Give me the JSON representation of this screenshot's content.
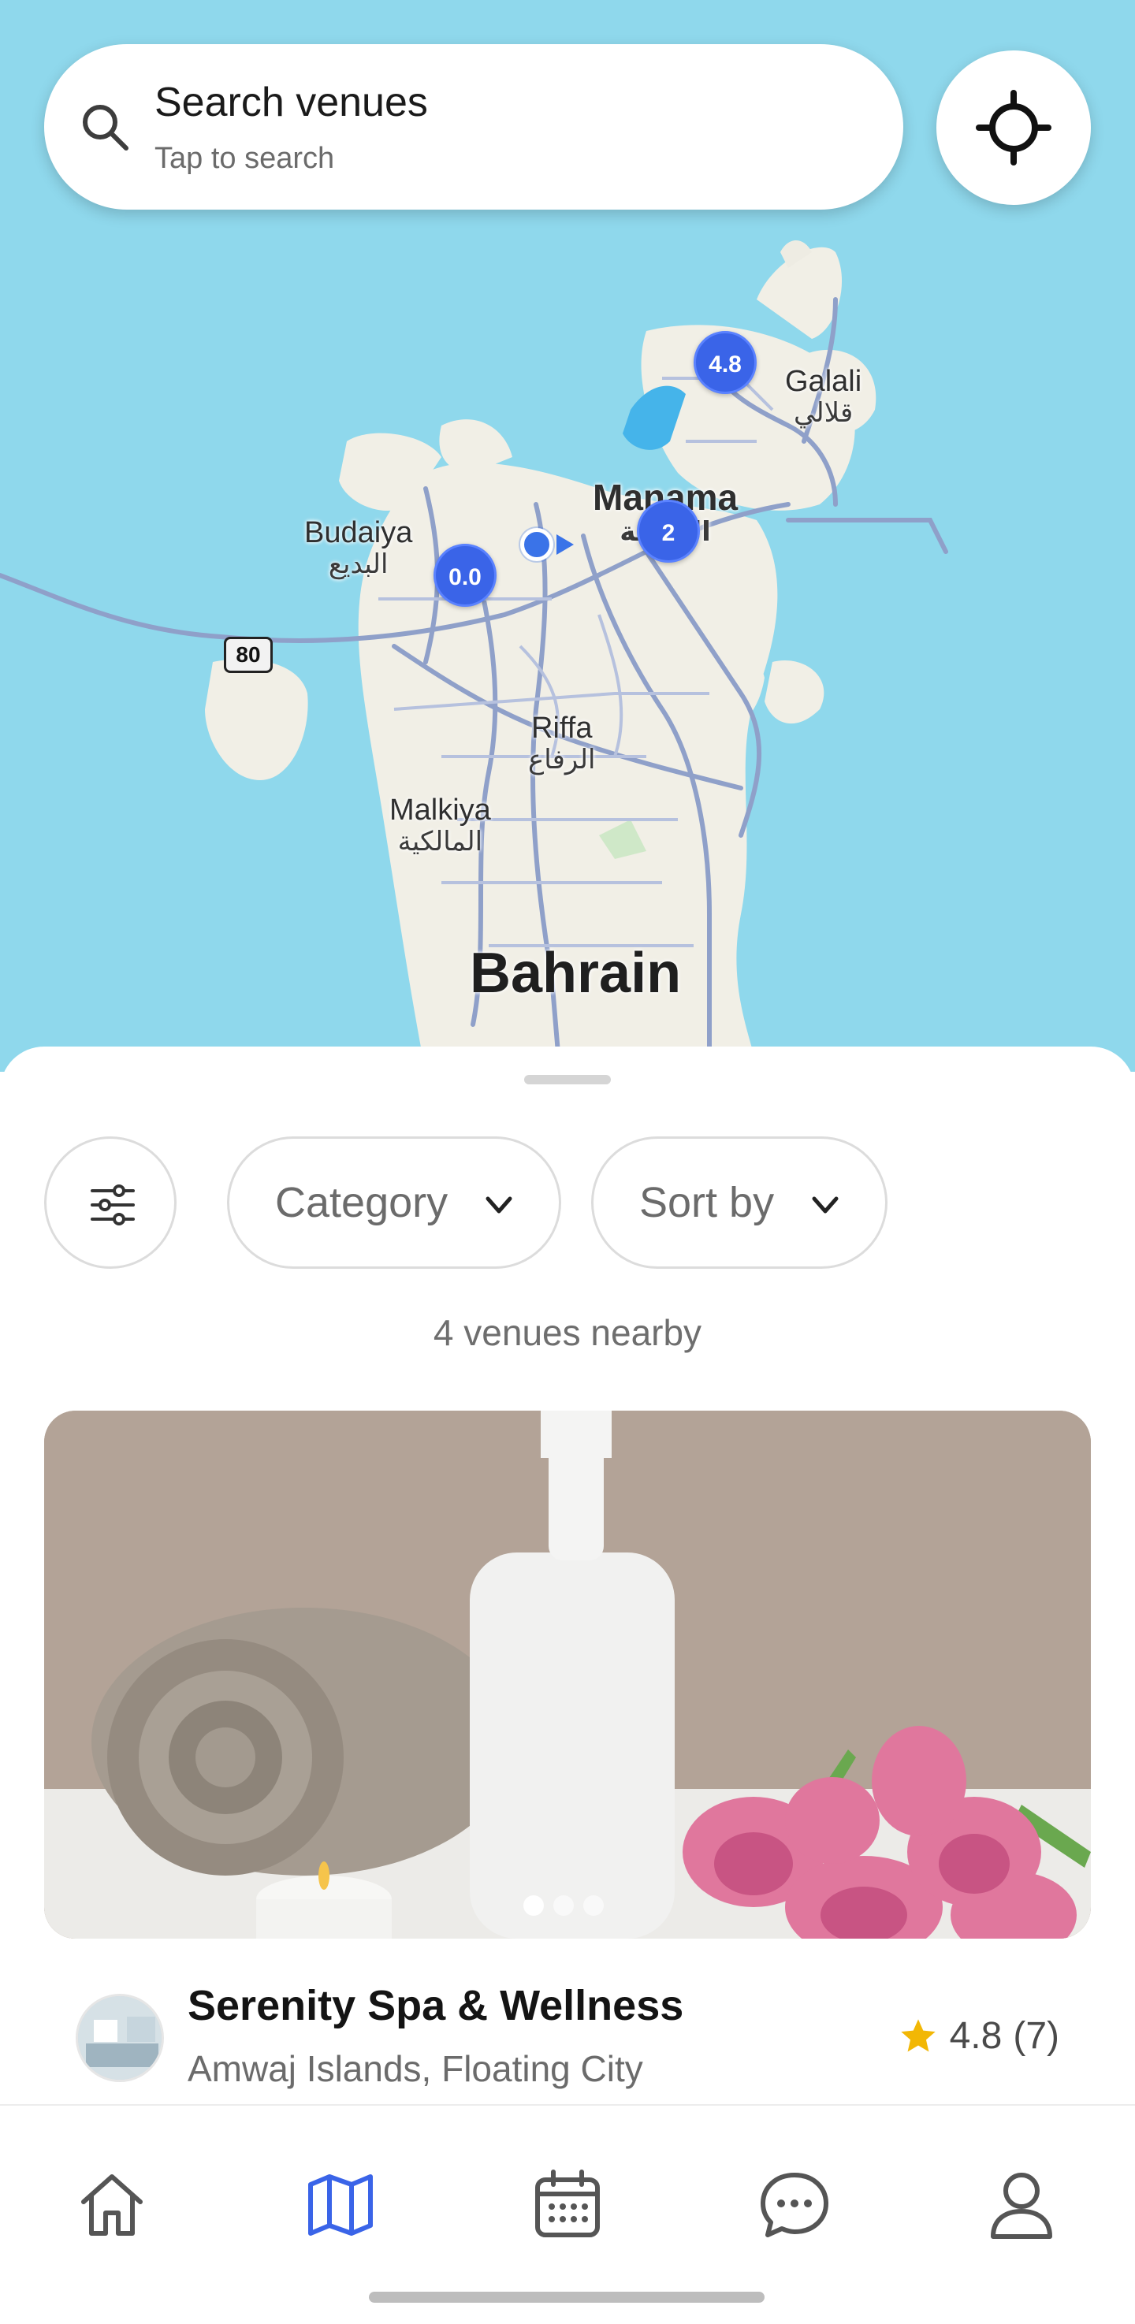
{
  "search": {
    "title": "Search venues",
    "subtitle": "Tap to search"
  },
  "map": {
    "places": [
      {
        "name": "Budaiya",
        "arabic": "البديع"
      },
      {
        "name": "Manama",
        "arabic": "المنامة"
      },
      {
        "name": "Galali",
        "arabic": "قلالي"
      },
      {
        "name": "Riffa",
        "arabic": "الرفاع"
      },
      {
        "name": "Malkiya",
        "arabic": "المالكية"
      },
      {
        "name": "Bahrain"
      }
    ],
    "road_shield": "80",
    "pins": [
      {
        "label": "4.8"
      },
      {
        "label": "2"
      },
      {
        "label": "0.0"
      }
    ]
  },
  "filters": {
    "category_label": "Category",
    "sort_label": "Sort by"
  },
  "results": {
    "count_text": "4 venues nearby"
  },
  "venue": {
    "name": "Serenity Spa & Wellness",
    "location": "Amwaj Islands, Floating City",
    "rating": "4.8",
    "reviews": "(7)",
    "image_count": 3,
    "active_image": 1
  },
  "nav": {
    "items": [
      {
        "icon": "home-icon",
        "active": false
      },
      {
        "icon": "map-icon",
        "active": true
      },
      {
        "icon": "calendar-icon",
        "active": false
      },
      {
        "icon": "chat-icon",
        "active": false
      },
      {
        "icon": "profile-icon",
        "active": false
      }
    ]
  },
  "colors": {
    "accent": "#3a64e8",
    "star": "#f2b705",
    "water": "#8fd8ec"
  }
}
